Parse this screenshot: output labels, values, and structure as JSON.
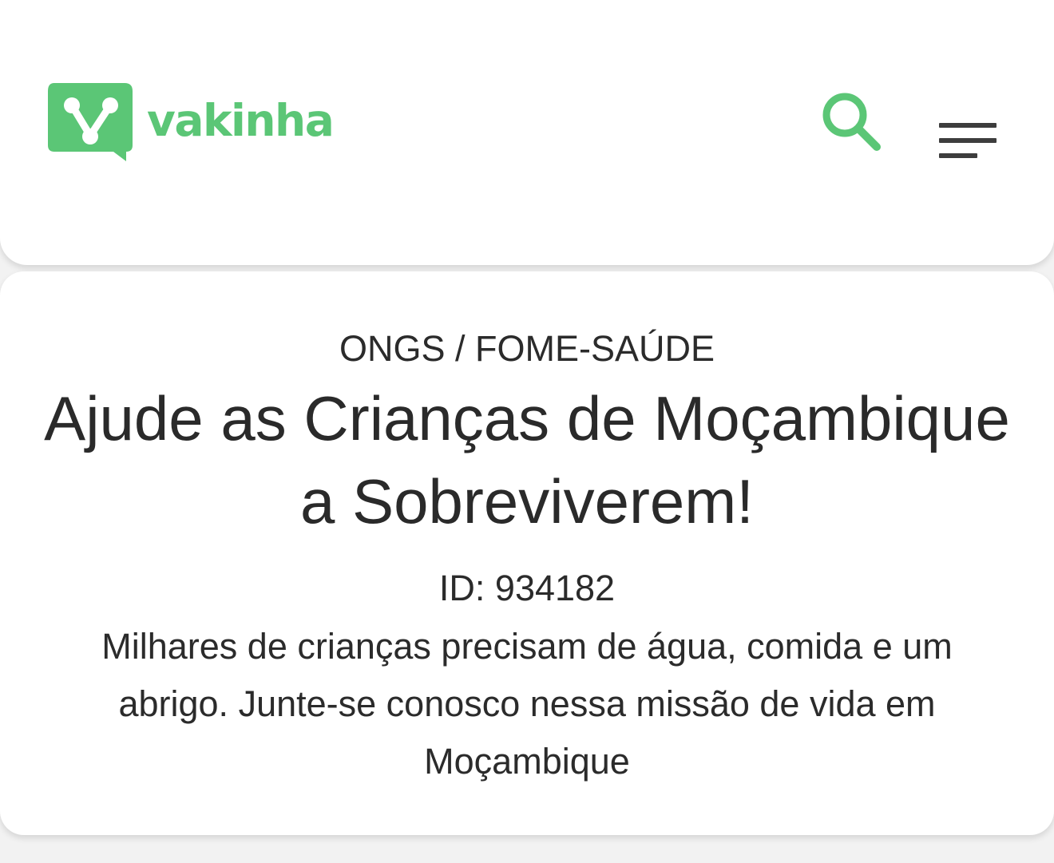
{
  "brand": {
    "name": "vakinha",
    "color": "#5bc676"
  },
  "header": {
    "search_icon": "search-icon",
    "menu_icon": "hamburger-menu-icon",
    "text_color": "#3d3d3d"
  },
  "campaign": {
    "category_parent": "ONGS",
    "category_separator": " / ",
    "category_child": "FOME-SAÚDE",
    "title": "Ajude as Crianças de Moçambique a Sobreviverem!",
    "id_label": "ID: 934182",
    "description": "Milhares de crianças precisam de água, comida e um abrigo. Junte-se conosco nessa missão de vida em Moçambique"
  }
}
